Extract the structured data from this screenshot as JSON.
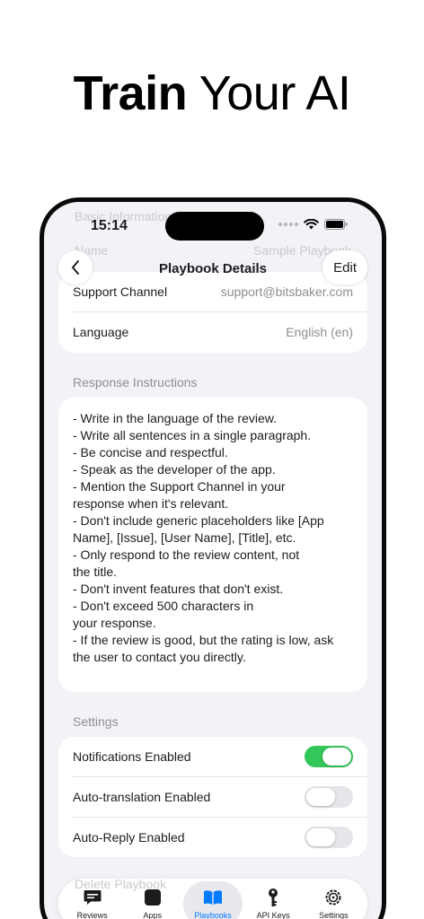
{
  "promo": {
    "headline_bold": "Train",
    "headline_light": "Your AI"
  },
  "status_bar": {
    "time": "15:14"
  },
  "ghost": {
    "top_text": "Basic Information",
    "name_label": "Name",
    "name_value": "Sample Playbook"
  },
  "nav": {
    "title": "Playbook Details",
    "back_icon": "chevron-left-icon",
    "edit_label": "Edit"
  },
  "basic_info": {
    "rows": [
      {
        "label": "Support Channel",
        "value": "support@bitsbaker.com"
      },
      {
        "label": "Language",
        "value": "English (en)"
      }
    ]
  },
  "response_instructions": {
    "section_label": "Response Instructions",
    "text": "- Write in the language of the review.\n- Write all sentences in a single paragraph.\n- Be concise and respectful.\n- Speak as the developer of the app.\n- Mention the Support Channel in your\nresponse when it's relevant.\n- Don't include generic placeholders like [App\nName], [Issue], [User Name], [Title], etc.\n- Only respond to the review content, not\nthe title.\n- Don't invent features that don't exist.\n- Don't exceed 500 characters in\nyour response.\n- If the review is good, but the rating is low, ask\nthe user to contact you directly."
  },
  "settings": {
    "section_label": "Settings",
    "items": [
      {
        "label": "Notifications Enabled",
        "enabled": true
      },
      {
        "label": "Auto-translation Enabled",
        "enabled": false
      },
      {
        "label": "Auto-Reply Enabled",
        "enabled": false
      }
    ]
  },
  "ghost_bottom": "Delete Playbook",
  "tabs": [
    {
      "label": "Reviews",
      "icon": "chat-bubble-icon",
      "active": false
    },
    {
      "label": "Apps",
      "icon": "app-square-icon",
      "active": false
    },
    {
      "label": "Playbooks",
      "icon": "book-icon",
      "active": true
    },
    {
      "label": "API Keys",
      "icon": "key-icon",
      "active": false
    },
    {
      "label": "Settings",
      "icon": "gear-icon",
      "active": false
    }
  ],
  "colors": {
    "accent": "#007aff",
    "toggle_on": "#34c759",
    "background": "#f2f2f7"
  }
}
